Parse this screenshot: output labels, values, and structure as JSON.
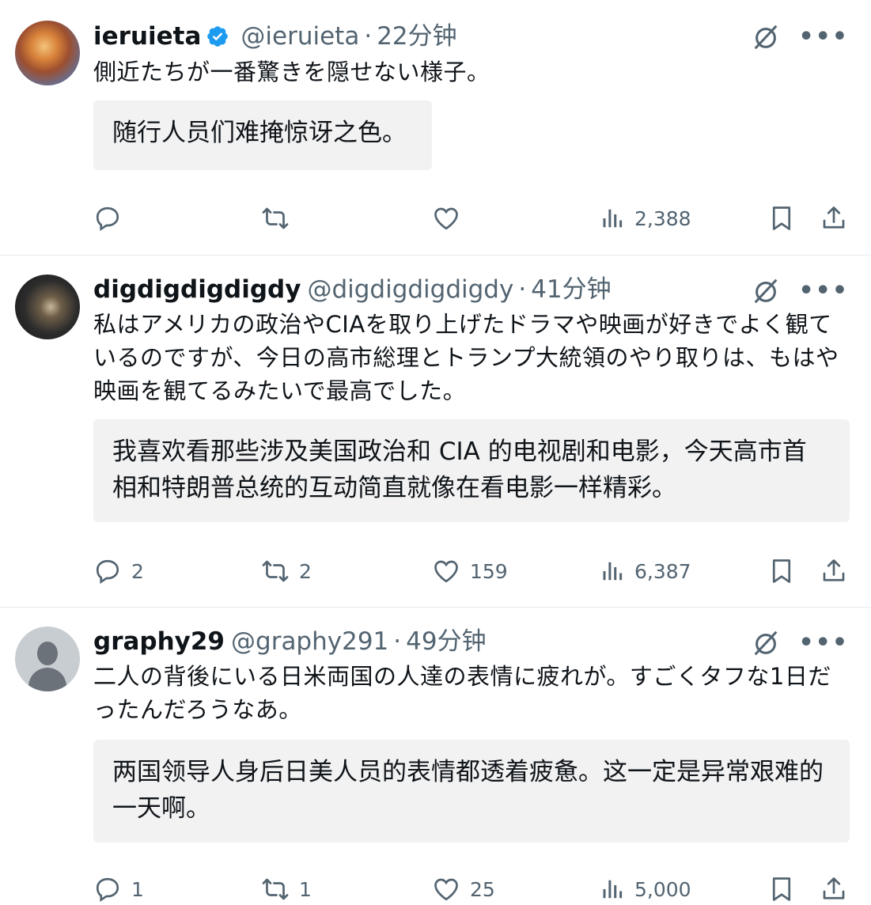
{
  "tweets": [
    {
      "name": "ieruieta",
      "verified": true,
      "handle": "@ieruieta",
      "sep": "·",
      "time": "22分钟",
      "text": "側近たちが一番驚きを隠せない様子。",
      "translation": "随行人员们难掩惊讶之色。",
      "reply_count": "",
      "retweet_count": "",
      "like_count": "",
      "view_count": "2,388"
    },
    {
      "name": "digdigdigdigdy",
      "verified": false,
      "handle": "@digdigdigdigdy",
      "sep": "·",
      "time": "41分钟",
      "text": "私はアメリカの政治やCIAを取り上げたドラマや映画が好きでよく観ているのですが、今日の高市総理とトランプ大統領のやり取りは、もはや映画を観てるみたいで最高でした。",
      "translation": "我喜欢看那些涉及美国政治和 CIA 的电视剧和电影，今天高市首相和特朗普总统的互动简直就像在看电影一样精彩。",
      "reply_count": "2",
      "retweet_count": "2",
      "like_count": "159",
      "view_count": "6,387"
    },
    {
      "name": "graphy29",
      "verified": false,
      "handle": "@graphy291",
      "sep": "·",
      "time": "49分钟",
      "text": "二人の背後にいる日米両国の人達の表情に疲れが。すごくタフな1日だったんだろうなあ。",
      "translation": "两国领导人身后日美人员的表情都透着疲惫。这一定是异常艰难的一天啊。",
      "reply_count": "1",
      "retweet_count": "1",
      "like_count": "25",
      "view_count": "5,000"
    }
  ],
  "colors": {
    "text": "#0f1419",
    "secondary": "#536471",
    "verified": "#1d9bf0",
    "translation_bg": "#f2f2f2",
    "divider": "#e6e9ec"
  },
  "icons": [
    "verified-badge-icon",
    "grok-icon",
    "more-icon",
    "reply-icon",
    "retweet-icon",
    "like-icon",
    "views-icon",
    "bookmark-icon",
    "share-icon"
  ]
}
